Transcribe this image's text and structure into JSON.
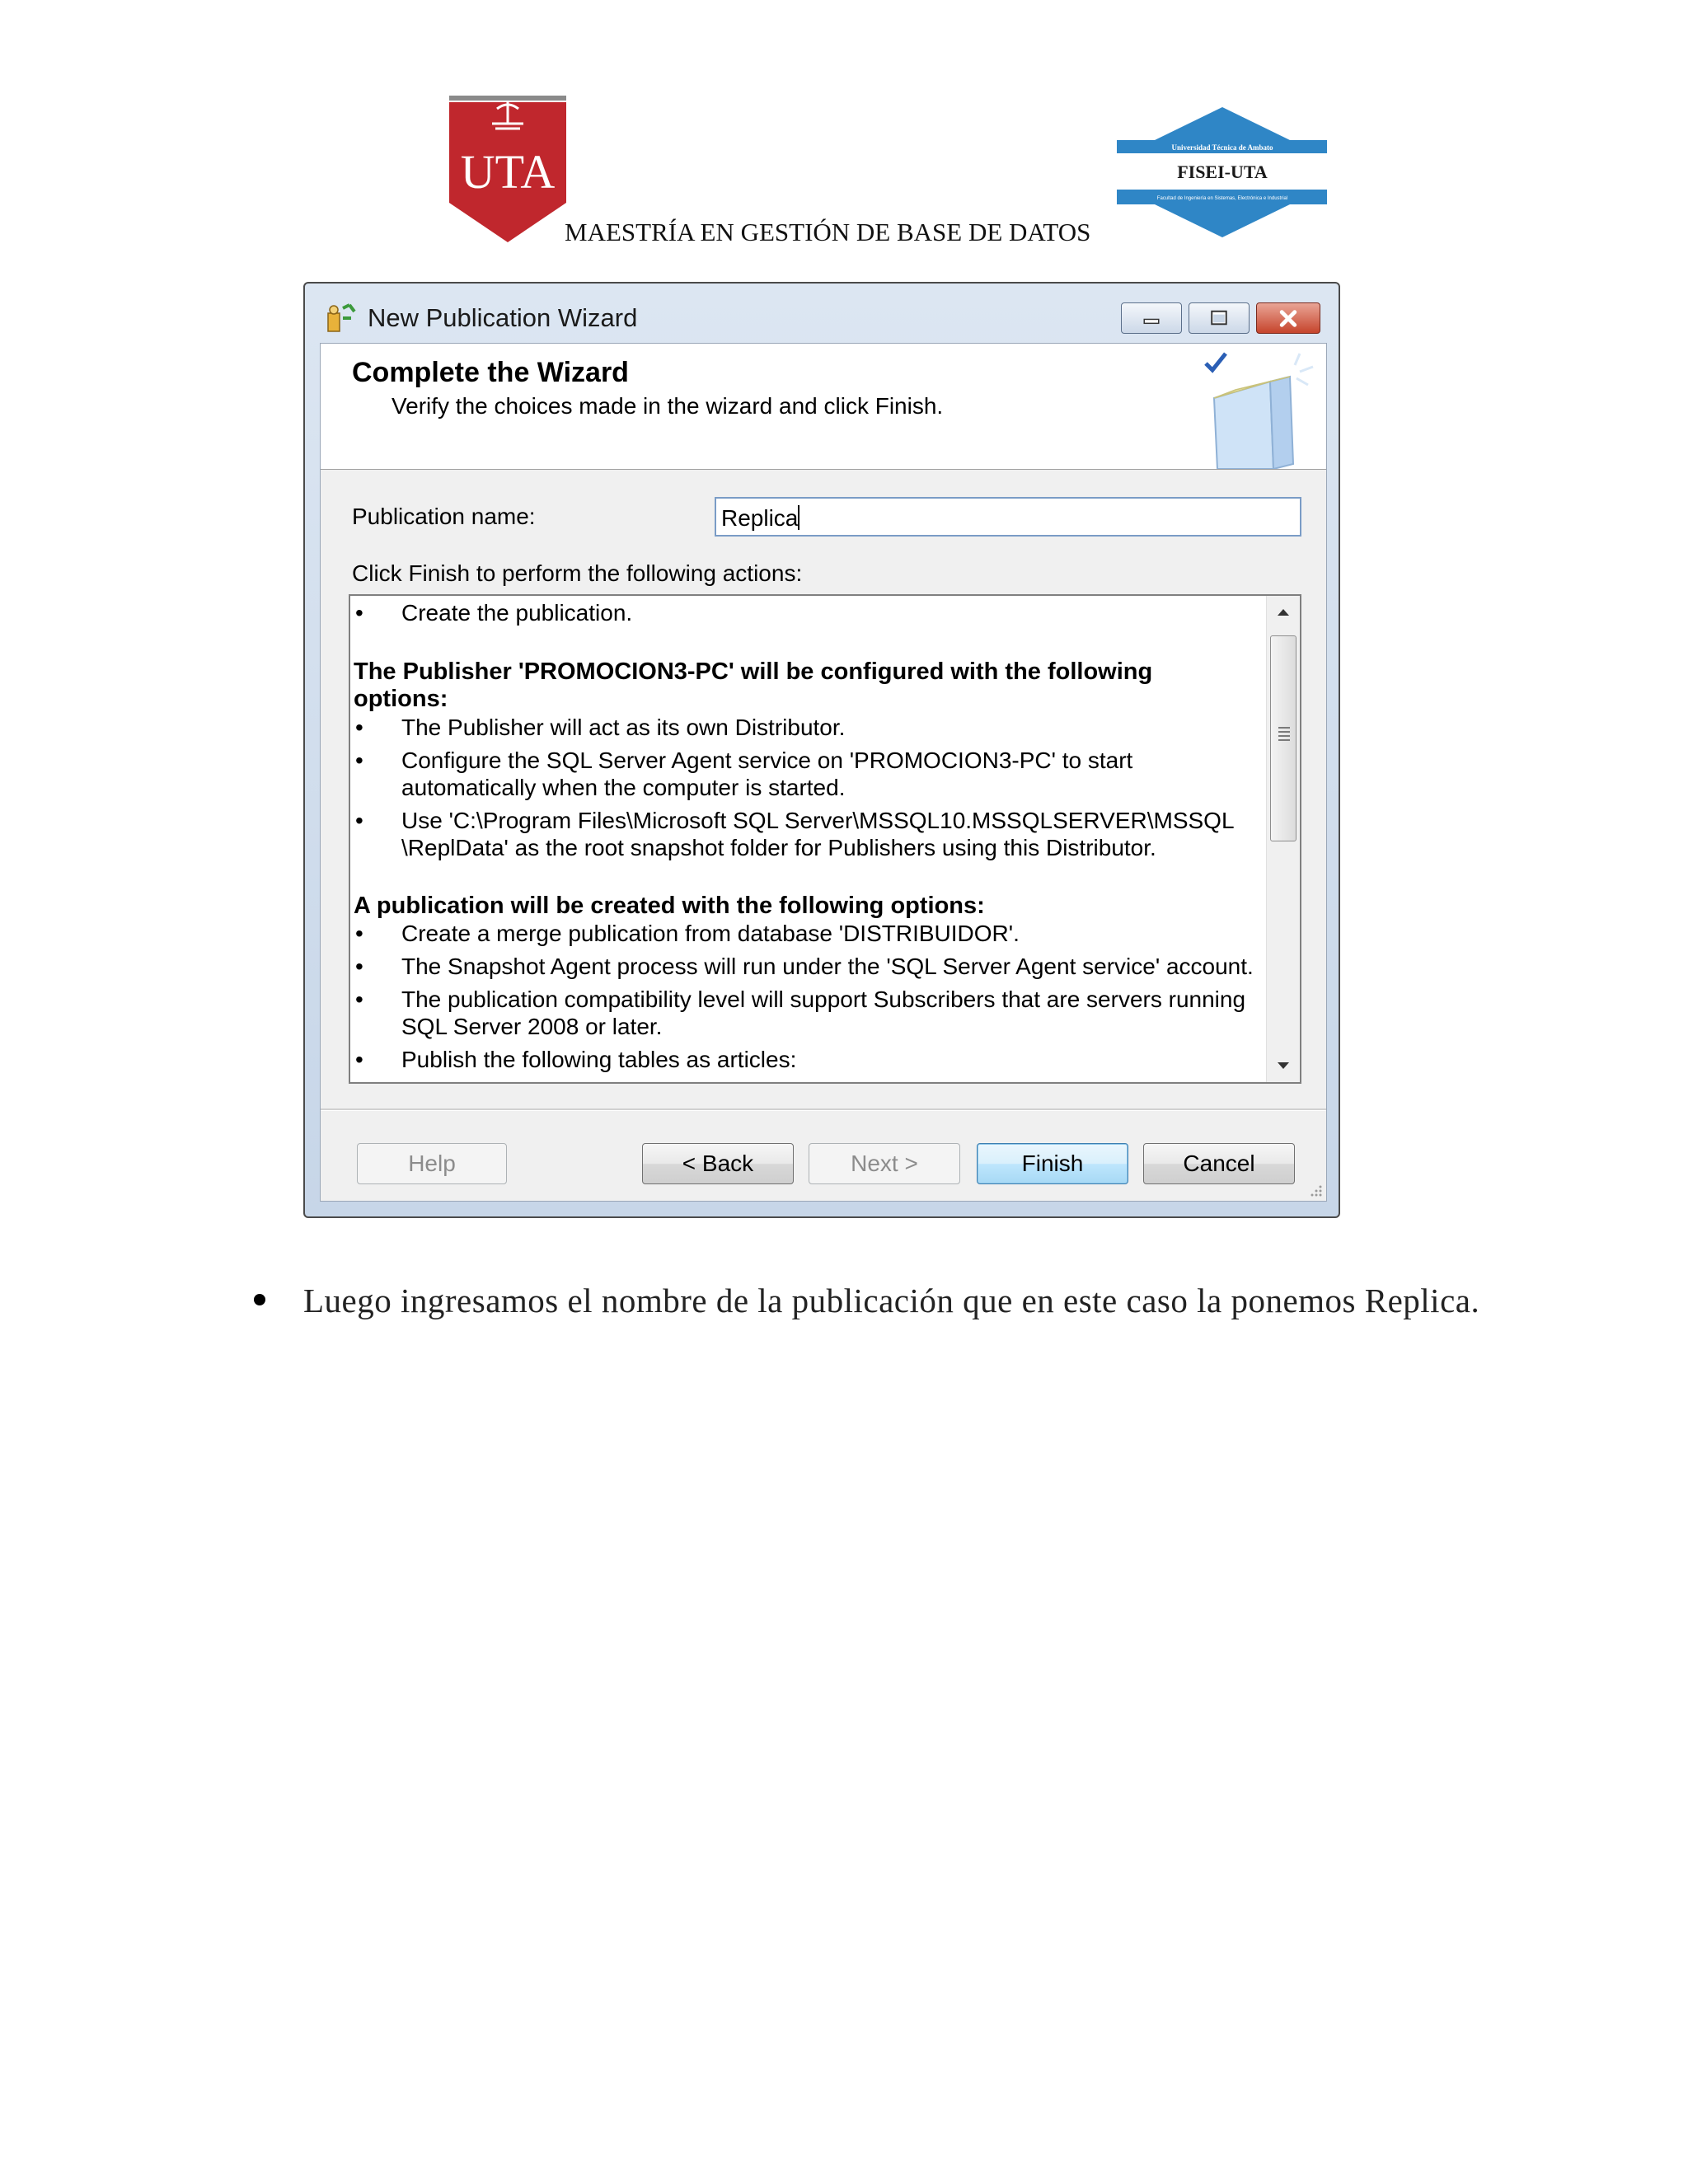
{
  "header": {
    "uta_logo_text": "UTA",
    "fisei_logo_top": "Universidad Técnica de Ambato",
    "fisei_logo_main": "FISEI-UTA",
    "fisei_logo_bottom": "Facultad de Ingeniería en Sistemas, Electrónica e Industrial",
    "title": "MAESTRÍA EN GESTIÓN DE BASE DE DATOS"
  },
  "dialog": {
    "window_title": "New Publication Wizard",
    "banner_title": "Complete the Wizard",
    "banner_subtitle": "Verify the choices made in the wizard and click Finish.",
    "publication_name_label": "Publication name:",
    "publication_name_value": "Replica",
    "actions_label": "Click Finish to perform the following actions:",
    "actions": [
      {
        "kind": "bullet",
        "text": "Create the publication."
      },
      {
        "kind": "heading",
        "text": "The Publisher 'PROMOCION3-PC' will be configured with the following options:"
      },
      {
        "kind": "bullet",
        "text": "The Publisher will act as its own Distributor."
      },
      {
        "kind": "bullet",
        "text": "Configure the SQL Server Agent service on 'PROMOCION3-PC' to start automatically when the computer is started."
      },
      {
        "kind": "bullet",
        "text": "Use 'C:\\Program Files\\Microsoft SQL Server\\MSSQL10.MSSQLSERVER\\MSSQL \\ReplData' as the root snapshot folder for Publishers using this Distributor."
      },
      {
        "kind": "heading",
        "text": "A publication will be created with the following options:"
      },
      {
        "kind": "bullet",
        "text": "Create a merge publication from database 'DISTRIBUIDOR'."
      },
      {
        "kind": "bullet",
        "text": "The Snapshot Agent process will run under the 'SQL Server Agent service' account."
      },
      {
        "kind": "bullet",
        "text": "The publication compatibility level will support Subscribers that are servers running SQL Server 2008 or later."
      },
      {
        "kind": "bullet",
        "text": "Publish the following tables as articles:"
      }
    ],
    "bullet_char": "•",
    "buttons": {
      "help": "Help",
      "back": "< Back",
      "next": "Next >",
      "finish": "Finish",
      "cancel": "Cancel"
    },
    "colors": {
      "uta_red": "#c0272d",
      "fisei_blue": "#2f86c6",
      "window_frame": "#c7d6e8"
    }
  },
  "body": {
    "bullet": "•",
    "paragraph": "Luego ingresamos el nombre de la publicación que en este caso la ponemos Replica."
  }
}
